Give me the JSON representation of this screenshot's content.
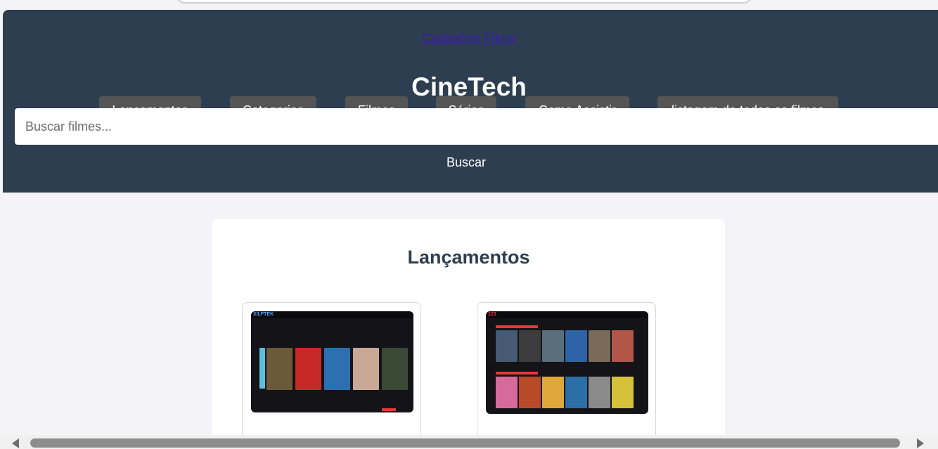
{
  "header": {
    "cadastrar_link": "Cadastrar Filme",
    "brand": "CineTech",
    "nav": [
      {
        "label": "Lançamentos"
      },
      {
        "label": "Categorias"
      },
      {
        "label": "Filmes"
      },
      {
        "label": "Séries"
      },
      {
        "label": "Como Assistir"
      },
      {
        "label": "listagem de todos os filmes"
      }
    ],
    "search_placeholder": "Buscar filmes...",
    "search_button": "Buscar"
  },
  "main": {
    "section_title": "Lançamentos",
    "cards": [
      {
        "name": "site-screenshot-1",
        "logo": "XILFTEK"
      },
      {
        "name": "site-screenshot-2",
        "logo": "123"
      }
    ]
  },
  "colors": {
    "header_bg": "#2c3e50",
    "nav_button_bg": "#555555",
    "page_bg": "#f4f4f8",
    "link": "#3b1bb0"
  }
}
